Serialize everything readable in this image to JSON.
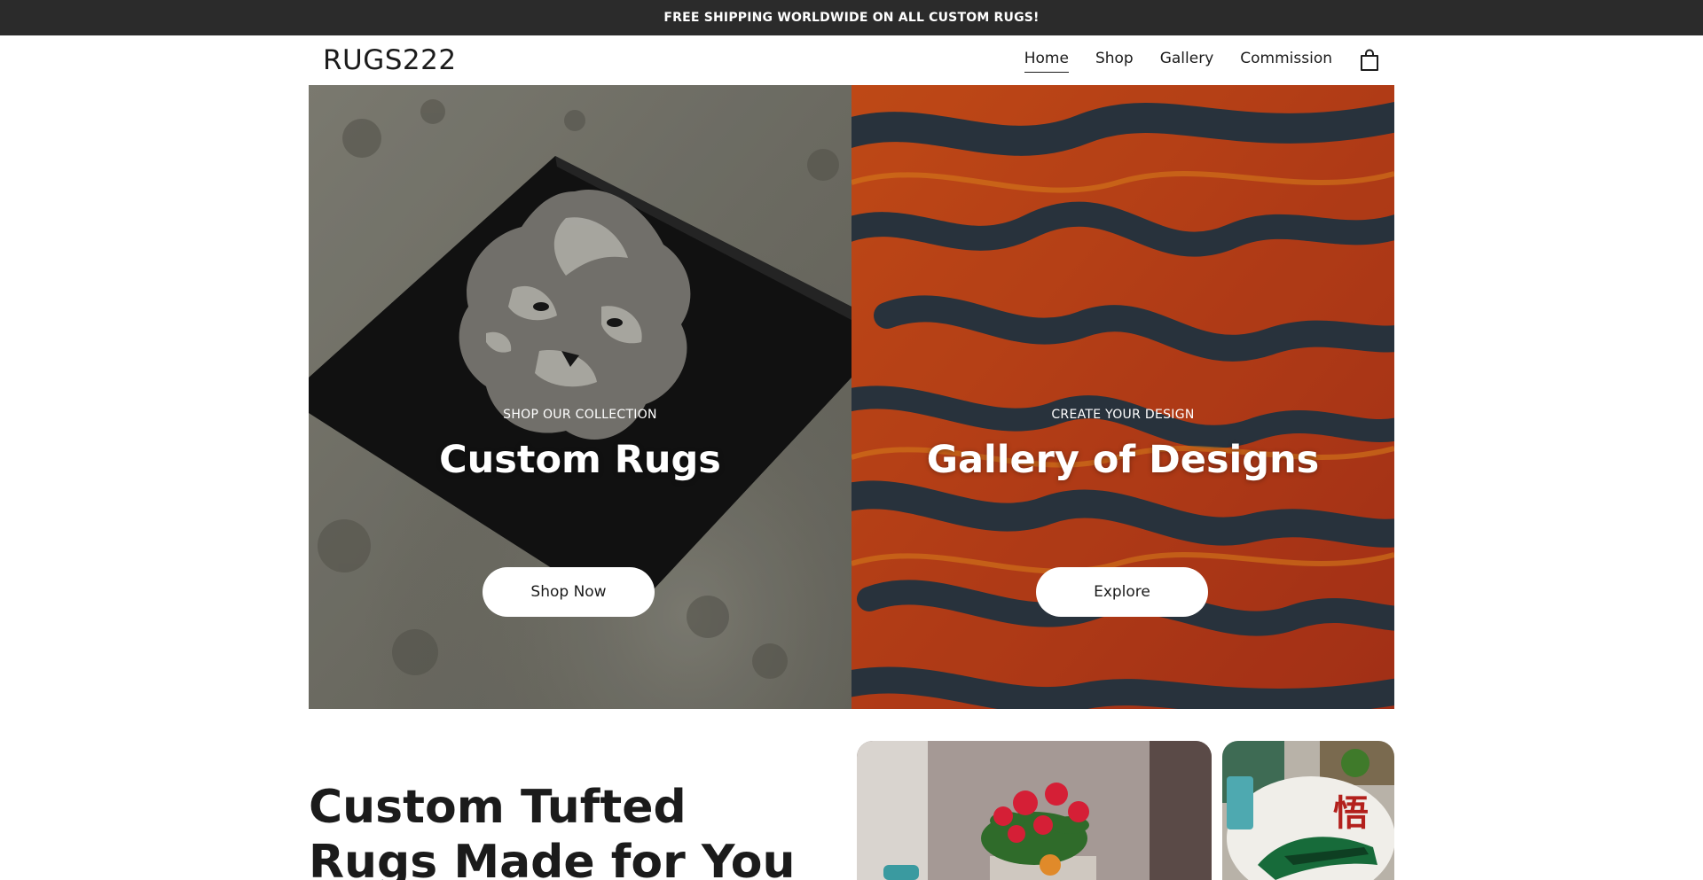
{
  "announcement": {
    "text": "FREE SHIPPING WORLDWIDE ON ALL CUSTOM RUGS!"
  },
  "header": {
    "logo": "RUGS222",
    "nav": [
      {
        "label": "Home",
        "active": true
      },
      {
        "label": "Shop",
        "active": false
      },
      {
        "label": "Gallery",
        "active": false
      },
      {
        "label": "Commission",
        "active": false
      }
    ],
    "cart_icon": "shopping-bag-icon"
  },
  "hero": {
    "left": {
      "eyebrow": "SHOP OUR COLLECTION",
      "title": "Custom Rugs",
      "button": "Shop Now",
      "image": "black tiger rug on concrete floor"
    },
    "right": {
      "eyebrow": "CREATE YOUR DESIGN",
      "title": "Gallery of Designs",
      "button": "Explore",
      "image": "orange and black flame pattern rug closeup"
    }
  },
  "intro": {
    "heading": "Custom Tufted Rugs Made for You"
  },
  "colors": {
    "announcement_bg": "#2b2b2b",
    "text": "#1b1b1b",
    "button_bg": "#ffffff"
  }
}
